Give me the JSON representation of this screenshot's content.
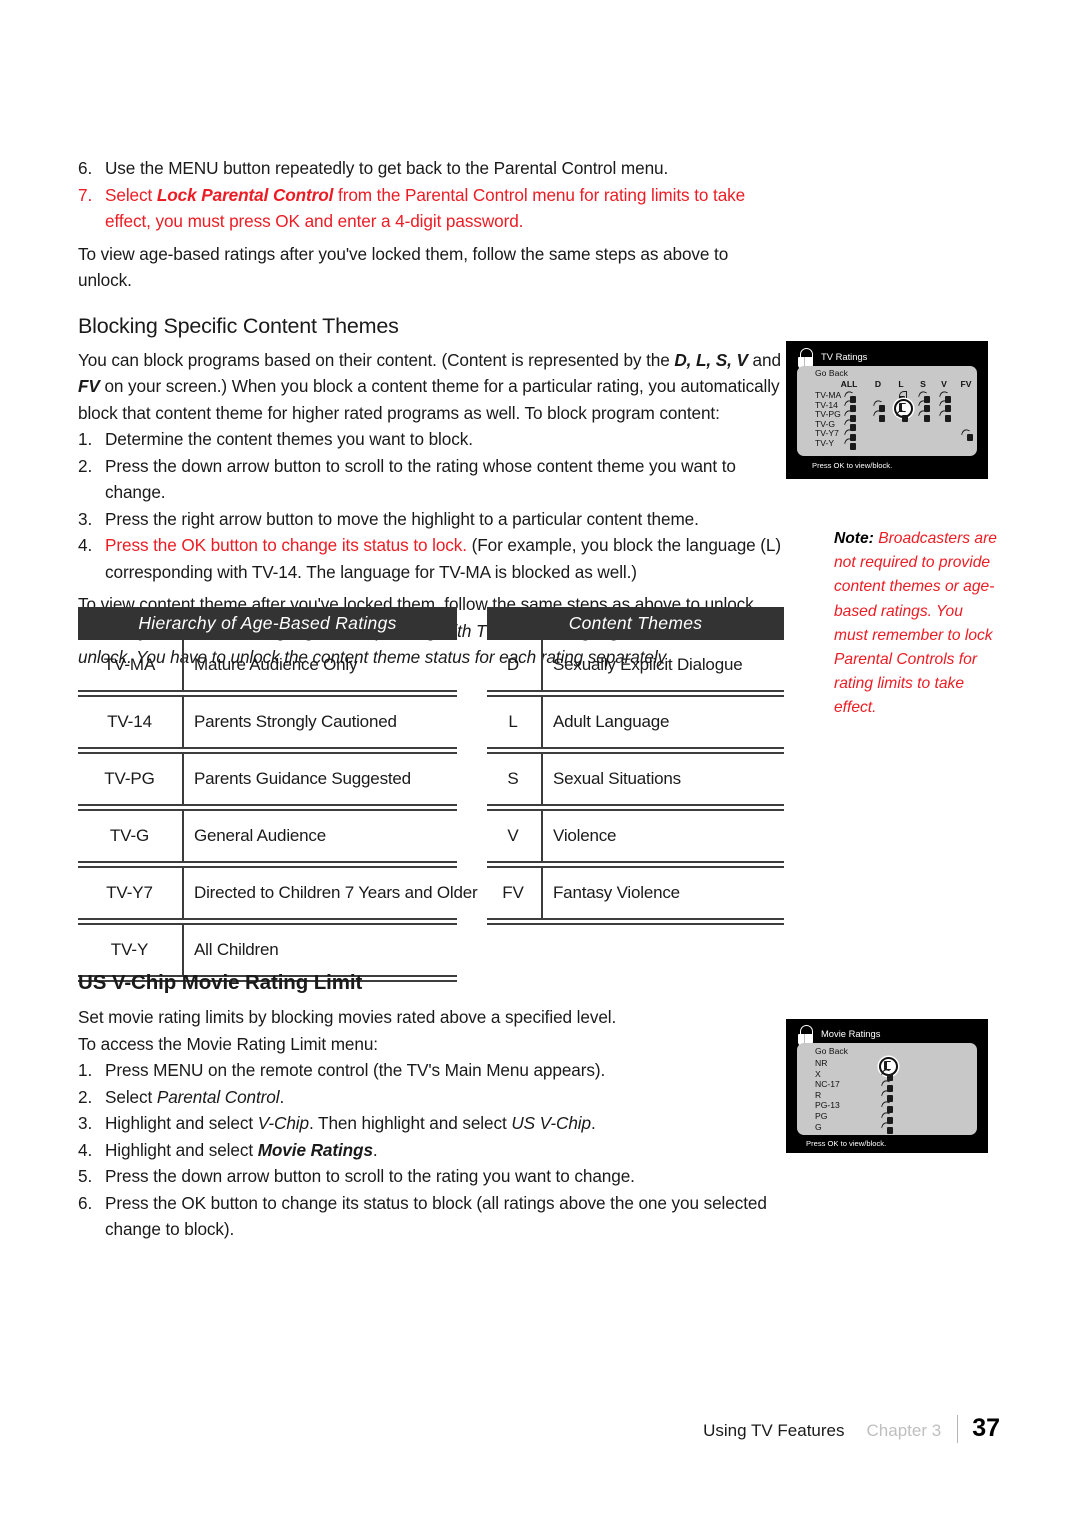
{
  "document": {
    "body_top": [
      {
        "num": "6.",
        "runs": [
          {
            "t": "Use the MENU button repeatedly to get back to the Parental Control menu.",
            "s": ""
          }
        ],
        "color": "black"
      },
      {
        "num": "7.",
        "runs": [
          {
            "t": "Select ",
            "s": ""
          },
          {
            "t": "Lock Parental Control",
            "s": "bi"
          },
          {
            "t": " from the Parental Control menu for rating limits to take effect, you must press OK and enter a 4-digit password.",
            "s": ""
          }
        ],
        "color": "red"
      }
    ],
    "unlock_line_1": "To view age-based ratings after you've locked them, follow the same steps as above to unlock.",
    "heading_blocking": "Blocking Specific Content Themes",
    "intro_runs": [
      {
        "t": "You can block programs based on their content. (Content is represented by the ",
        "s": ""
      },
      {
        "t": "D, L, S, V",
        "s": "bi"
      },
      {
        "t": " and ",
        "s": ""
      },
      {
        "t": "FV",
        "s": "bi"
      },
      {
        "t": " on your screen.) When you block a content theme for a particular rating, you automatically block that content theme for higher rated programs as well. To block program content:",
        "s": ""
      }
    ],
    "steps_block": [
      {
        "num": "1.",
        "runs": [
          {
            "t": "Determine the content themes you want to block.",
            "s": ""
          }
        ],
        "color": "black"
      },
      {
        "num": "2.",
        "runs": [
          {
            "t": "Press the down arrow button to scroll to the rating whose content theme you want to change.",
            "s": ""
          }
        ],
        "color": "black"
      },
      {
        "num": "3.",
        "runs": [
          {
            "t": "Press the right arrow button to move the highlight to a particular content theme.",
            "s": ""
          }
        ],
        "color": "black"
      },
      {
        "num": "4.",
        "runs": [
          {
            "t": "Press the OK button to change its status to lock.",
            "s": "red"
          },
          {
            "t": " (For example, you block the  language (L) corresponding with TV-14. The language for TV-MA is blocked as well.)",
            "s": ""
          }
        ],
        "color": "black"
      }
    ],
    "unlock_line_2": "To view content theme after you've locked them, follow the same steps as above to unlock.",
    "note_inline": {
      "label": "Note:",
      "text": " If you unlock the language corresponding with TV-14, the language for TV-MA doesn't unlock. You have to unlock the content theme status for each rating separately."
    },
    "heading_vchip": "US V-Chip Movie Rating Limit",
    "vchip_intro_1": "Set movie rating limits by blocking movies rated above a specified level.",
    "vchip_intro_2": "To access the Movie Rating Limit menu:",
    "steps_vchip": [
      {
        "num": "1.",
        "runs": [
          {
            "t": "Press MENU on the remote control (the TV's Main Menu appears).",
            "s": ""
          }
        ],
        "color": "black"
      },
      {
        "num": "2.",
        "runs": [
          {
            "t": "Select ",
            "s": ""
          },
          {
            "t": "Parental Control",
            "s": "ital"
          },
          {
            "t": ".",
            "s": ""
          }
        ],
        "color": "black"
      },
      {
        "num": "3.",
        "runs": [
          {
            "t": "Highlight and select ",
            "s": ""
          },
          {
            "t": "V-Chip",
            "s": "ital"
          },
          {
            "t": ". Then highlight and select ",
            "s": ""
          },
          {
            "t": "US V-Chip",
            "s": "ital"
          },
          {
            "t": ".",
            "s": ""
          }
        ],
        "color": "black"
      },
      {
        "num": "4.",
        "runs": [
          {
            "t": "Highlight and select ",
            "s": ""
          },
          {
            "t": "Movie Ratings",
            "s": "bi"
          },
          {
            "t": ".",
            "s": ""
          }
        ],
        "color": "black"
      },
      {
        "num": "5.",
        "runs": [
          {
            "t": "Press the down arrow button to scroll to the rating you want to change.",
            "s": ""
          }
        ],
        "color": "black"
      },
      {
        "num": "6.",
        "runs": [
          {
            "t": "Press the OK button to change its status to block (all ratings above the one you selected change to block).",
            "s": ""
          }
        ],
        "color": "black"
      }
    ]
  },
  "side_note": {
    "label": "Note:",
    "text": " Broadcasters are not required to provide content themes or age-based ratings. You must remember to lock Parental Controls for rating limits to take effect."
  },
  "osd_tv_ratings": {
    "title": "TV Ratings",
    "icon": "padlock-pail-icon",
    "go_back": "Go Back",
    "columns": [
      "ALL",
      "D",
      "L",
      "S",
      "V",
      "FV"
    ],
    "rows": [
      {
        "label": "TV-MA",
        "locks": {
          "ALL": "open",
          "D": "none",
          "L": "closed",
          "S": "open",
          "V": "open",
          "FV": "none"
        }
      },
      {
        "label": "TV-14",
        "locks": {
          "ALL": "open",
          "D": "open",
          "L": "selected",
          "S": "open",
          "V": "open",
          "FV": "none"
        }
      },
      {
        "label": "TV-PG",
        "locks": {
          "ALL": "open",
          "D": "open",
          "L": "open",
          "S": "open",
          "V": "open",
          "FV": "none"
        }
      },
      {
        "label": "TV-G",
        "locks": {
          "ALL": "open",
          "D": "none",
          "L": "none",
          "S": "none",
          "V": "none",
          "FV": "none"
        }
      },
      {
        "label": "TV-Y7",
        "locks": {
          "ALL": "open",
          "D": "none",
          "L": "none",
          "S": "none",
          "V": "none",
          "FV": "open"
        }
      },
      {
        "label": "TV-Y",
        "locks": {
          "ALL": "open",
          "D": "none",
          "L": "none",
          "S": "none",
          "V": "none",
          "FV": "none"
        }
      }
    ],
    "footer": "Press OK to view/block."
  },
  "osd_movie_ratings": {
    "title": "Movie Ratings",
    "icon": "padlock-pail-icon",
    "go_back": "Go Back",
    "rows": [
      {
        "label": "NR",
        "lock": "selected"
      },
      {
        "label": "X",
        "lock": "open"
      },
      {
        "label": "NC-17",
        "lock": "open"
      },
      {
        "label": "R",
        "lock": "open"
      },
      {
        "label": "PG-13",
        "lock": "open"
      },
      {
        "label": "PG",
        "lock": "open"
      },
      {
        "label": "G",
        "lock": "open"
      }
    ],
    "footer": "Press OK to view/block."
  },
  "table_age": {
    "header": "Hierarchy of Age-Based Ratings",
    "rows": [
      {
        "code": "TV-MA",
        "desc": "Mature Audience Only"
      },
      {
        "code": "TV-14",
        "desc": "Parents Strongly Cautioned"
      },
      {
        "code": "TV-PG",
        "desc": "Parents Guidance Suggested"
      },
      {
        "code": "TV-G",
        "desc": "General Audience"
      },
      {
        "code": "TV-Y7",
        "desc": "Directed to Children 7 Years and Older"
      },
      {
        "code": "TV-Y",
        "desc": "All Children"
      }
    ]
  },
  "table_themes": {
    "header": "Content Themes",
    "rows": [
      {
        "code": "D",
        "desc": "Sexually Explicit Dialogue"
      },
      {
        "code": "L",
        "desc": "Adult Language"
      },
      {
        "code": "S",
        "desc": "Sexual Situations"
      },
      {
        "code": "V",
        "desc": "Violence"
      },
      {
        "code": "FV",
        "desc": "Fantasy Violence"
      }
    ]
  },
  "footer": {
    "section": "Using TV Features",
    "chapter": "Chapter 3",
    "page": "37"
  },
  "colors": {
    "accent_red": "#ec1c24",
    "table_header_bg": "#333333",
    "osd_panel_bg": "#c8c8c8",
    "osd_bg": "#000000",
    "chapter_gray": "#bfbfbf"
  }
}
